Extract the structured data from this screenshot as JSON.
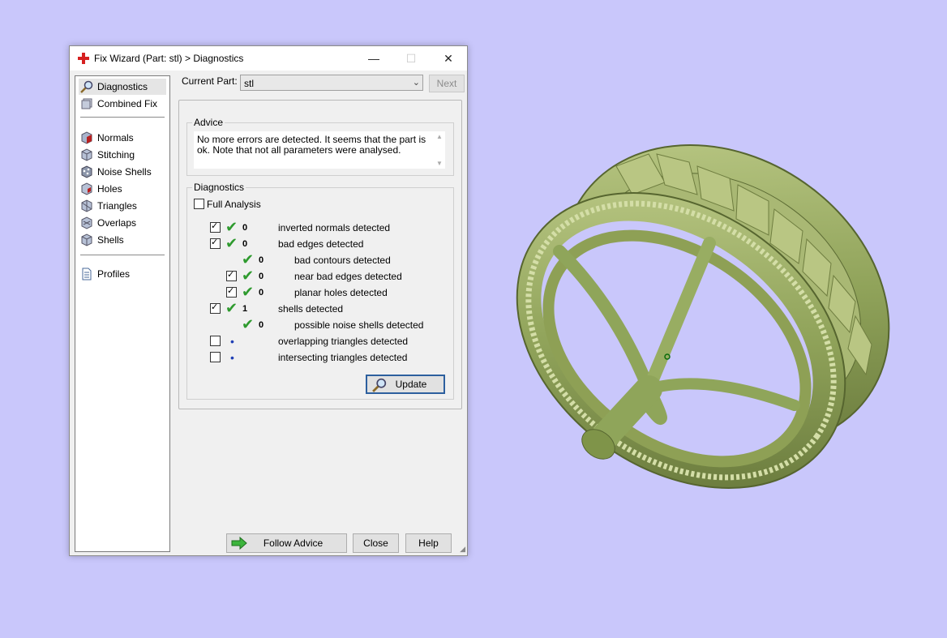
{
  "window": {
    "title": "Fix Wizard (Part: stl) > Diagnostics"
  },
  "sidebar": {
    "items": [
      {
        "label": "Diagnostics",
        "icon": "magnifier-icon",
        "selected": true
      },
      {
        "label": "Combined Fix",
        "icon": "cube-stack-icon"
      },
      {
        "label": "Normals",
        "icon": "normals-cube-icon"
      },
      {
        "label": "Stitching",
        "icon": "stitching-cube-icon"
      },
      {
        "label": "Noise Shells",
        "icon": "noise-shells-icon"
      },
      {
        "label": "Holes",
        "icon": "holes-cube-icon"
      },
      {
        "label": "Triangles",
        "icon": "triangles-cube-icon"
      },
      {
        "label": "Overlaps",
        "icon": "overlaps-cube-icon"
      },
      {
        "label": "Shells",
        "icon": "shells-cube-icon"
      },
      {
        "label": "Profiles",
        "icon": "document-icon"
      }
    ]
  },
  "current_part": {
    "label": "Current Part:",
    "value": "stl"
  },
  "next_label": "Next",
  "advice": {
    "title": "Advice",
    "text": "No more errors are detected. It seems that the part is ok. Note that not all parameters were analysed."
  },
  "diagnostics": {
    "title": "Diagnostics",
    "full_analysis_label": "Full Analysis",
    "rows": [
      {
        "checkbox": true,
        "checked": true,
        "status": "ok",
        "count": "0",
        "label": "inverted normals detected"
      },
      {
        "checkbox": true,
        "checked": true,
        "status": "ok",
        "count": "0",
        "label": "bad edges detected"
      },
      {
        "checkbox": false,
        "status": "ok",
        "count": "0",
        "label": "bad contours detected"
      },
      {
        "checkbox": true,
        "checked": true,
        "status": "ok",
        "count": "0",
        "label": "near bad edges detected"
      },
      {
        "checkbox": true,
        "checked": true,
        "status": "ok",
        "count": "0",
        "label": "planar holes detected"
      },
      {
        "checkbox": true,
        "checked": true,
        "status": "ok",
        "count": "1",
        "label": "shells detected"
      },
      {
        "checkbox": false,
        "status": "ok",
        "count": "0",
        "label": "possible noise shells detected"
      },
      {
        "checkbox": true,
        "checked": false,
        "status": "not-analysed",
        "count": "",
        "label": "overlapping triangles detected"
      },
      {
        "checkbox": true,
        "checked": false,
        "status": "not-analysed",
        "count": "",
        "label": "intersecting triangles detected"
      }
    ]
  },
  "buttons": {
    "update": "Update",
    "follow_advice": "Follow Advice",
    "close": "Close",
    "help": "Help"
  },
  "colors": {
    "background": "#c9c7fb",
    "model": "#8fa55a",
    "check": "#2e9a2e"
  }
}
